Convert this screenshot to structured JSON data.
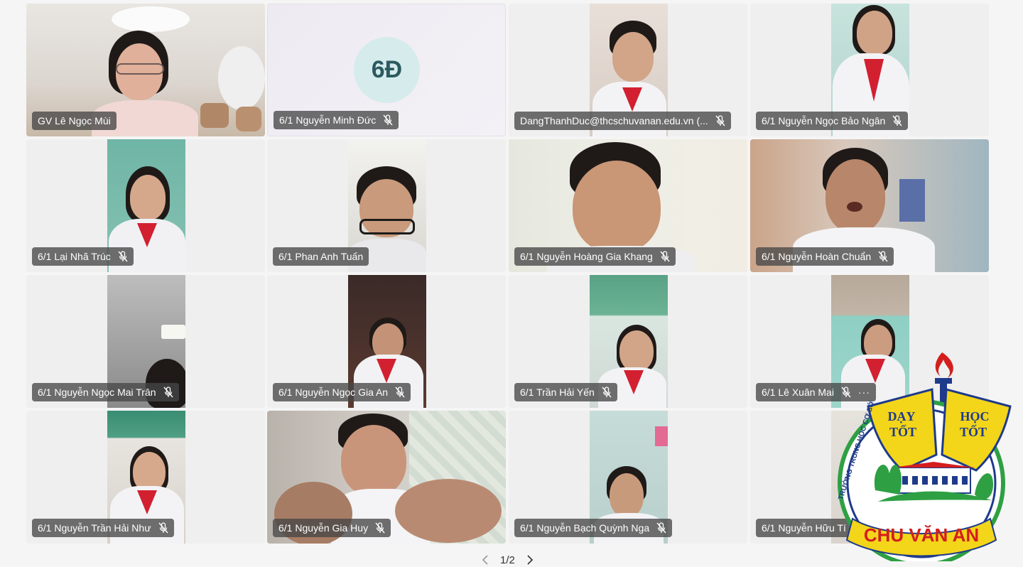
{
  "participants": [
    {
      "name": "GV Lê Ngọc Mùi",
      "muted": false
    },
    {
      "name": "6/1 Nguyễn Minh Đức",
      "muted": true,
      "initials": "6Đ"
    },
    {
      "name": "DangThanhDuc@thcschuvanan.edu.vn (...",
      "muted": true
    },
    {
      "name": "6/1 Nguyễn Ngọc Bảo Ngân",
      "muted": true
    },
    {
      "name": "6/1 Lại Nhã Trúc",
      "muted": true
    },
    {
      "name": "6/1 Phan Anh Tuấn",
      "muted": false
    },
    {
      "name": "6/1 Nguyễn Hoàng Gia Khang",
      "muted": true
    },
    {
      "name": "6/1 Nguyễn Hoàn Chuẩn",
      "muted": true
    },
    {
      "name": "6/1 Nguyễn Ngọc Mai Trân",
      "muted": true
    },
    {
      "name": "6/1 Nguyễn Ngọc Gia An",
      "muted": true
    },
    {
      "name": "6/1 Trần Hải Yến",
      "muted": true
    },
    {
      "name": "6/1 Lê Xuân Mai",
      "muted": true,
      "more": "···"
    },
    {
      "name": "6/1 Nguyễn Trần Hải Như",
      "muted": true
    },
    {
      "name": "6/1 Nguyễn Gia Huy",
      "muted": true
    },
    {
      "name": "6/1 Nguyễn Bạch Quỳnh Nga",
      "muted": true
    },
    {
      "name": "6/1 Nguyễn Hữu Tí",
      "muted": false
    }
  ],
  "pager": {
    "text": "1/2",
    "prev_icon": "chevron-left-icon",
    "next_icon": "chevron-right-icon"
  },
  "logo": {
    "left_text_line1": "DẠY",
    "left_text_line2": "TỐT",
    "right_text_line1": "HỌC",
    "right_text_line2": "TỐT",
    "ring_text": "TRƯỜNG TRUNG HỌC CƠ SỞ",
    "banner_text": "CHU VĂN AN"
  },
  "colors": {
    "label_bg": "#464646",
    "scarf": "#d22030",
    "logo_yellow": "#f3d51a",
    "logo_blue": "#1e3a8a",
    "logo_red": "#d41e1e",
    "logo_green": "#2ea043"
  }
}
